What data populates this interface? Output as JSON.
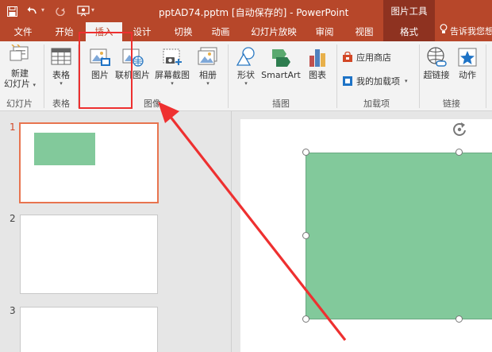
{
  "titlebar": {
    "doc_title": "pptAD74.pptm [自动保存的] - PowerPoint",
    "contextual_title": "图片工具"
  },
  "tabs": [
    {
      "label": "文件"
    },
    {
      "label": "开始"
    },
    {
      "label": "插入"
    },
    {
      "label": "设计"
    },
    {
      "label": "切换"
    },
    {
      "label": "动画"
    },
    {
      "label": "幻灯片放映"
    },
    {
      "label": "审阅"
    },
    {
      "label": "视图"
    },
    {
      "label": "格式"
    }
  ],
  "tell_me": "告诉我您想",
  "ribbon": {
    "new_slide": {
      "line1": "新建",
      "line2": "幻灯片"
    },
    "table": "表格",
    "picture": "图片",
    "online_picture": "联机图片",
    "screenshot": "屏幕截图",
    "album": "相册",
    "shapes": "形状",
    "smartart": "SmartArt",
    "chart": "图表",
    "app_store": "应用商店",
    "my_addins": "我的加载项",
    "hyperlink": "超链接",
    "action": "动作",
    "groups": {
      "slides": "幻灯片",
      "tables": "表格",
      "images": "图像",
      "illustrations": "插图",
      "addins": "加载项",
      "links": "链接"
    }
  },
  "slides": [
    {
      "number": "1"
    },
    {
      "number": "2"
    },
    {
      "number": "3"
    }
  ],
  "colors": {
    "accent": "#b7472a",
    "shape_fill": "#82c99b",
    "annotation": "#ee3030"
  }
}
